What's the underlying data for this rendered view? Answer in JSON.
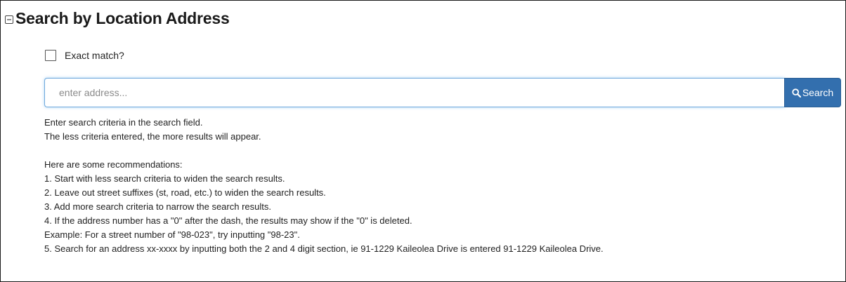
{
  "section": {
    "title": "Search by Location Address",
    "collapse_icon": "minus-square-icon"
  },
  "exact_match": {
    "label": "Exact match?",
    "checked": false
  },
  "search": {
    "placeholder": "enter address...",
    "value": "",
    "button_label": "Search",
    "button_icon": "search-icon",
    "button_color": "#336fae",
    "focus_border_color": "#6fa8dc"
  },
  "help": {
    "intro": [
      "Enter search criteria in the search field.",
      "The less criteria entered, the more results will appear."
    ],
    "recommendations": [
      "Here are some recommendations:",
      "1. Start with less search criteria to widen the search results.",
      "2. Leave out street suffixes (st, road, etc.) to widen the search results.",
      "3. Add more search criteria to narrow the search results.",
      "4. If the address number has a \"0\" after the dash, the results may show if the \"0\" is deleted.",
      "Example: For a street number of \"98-023\", try inputting \"98-23\".",
      "5. Search for an address xx-xxxx by inputting both the 2 and 4 digit section, ie 91-1229 Kaileolea Drive is entered 91-1229 Kaileolea Drive."
    ]
  }
}
